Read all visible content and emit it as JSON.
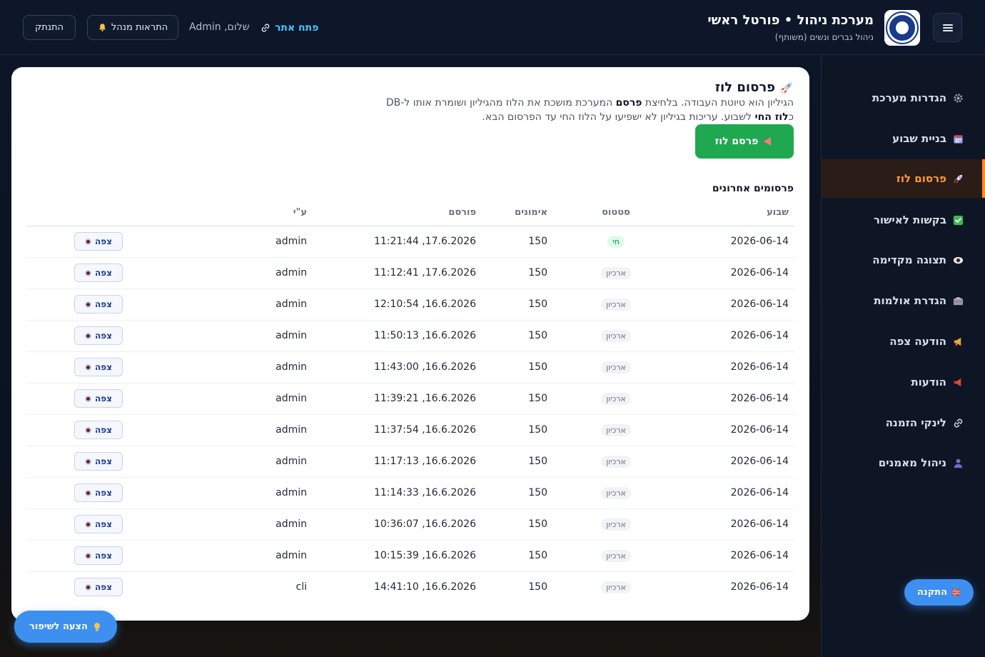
{
  "header": {
    "title": "מערכת ניהול • פורטל ראשי",
    "subtitle": "ניהול גברים ונשים (משותף)",
    "site_link": "פתח אתר",
    "greeting": "שלום, Admin",
    "notify_label": "התראות מנהל",
    "logout_label": "התנתק"
  },
  "sidebar": {
    "items": [
      {
        "label": "הגדרות מערכת",
        "icon": "gear-icon"
      },
      {
        "label": "בניית שבוע",
        "icon": "calendar-icon"
      },
      {
        "label": "פרסום לוז",
        "icon": "rocket-icon",
        "active": true
      },
      {
        "label": "בקשות לאישור",
        "icon": "check-icon"
      },
      {
        "label": "תצוגה מקדימה",
        "icon": "eye-icon"
      },
      {
        "label": "הגדרת אולמות",
        "icon": "stadium-icon"
      },
      {
        "label": "הודעה צפה",
        "icon": "megaphone-icon"
      },
      {
        "label": "הודעות",
        "icon": "loudspeaker-icon"
      },
      {
        "label": "לינקי הזמנה",
        "icon": "link-icon"
      },
      {
        "label": "ניהול מאמנים",
        "icon": "user-icon"
      }
    ]
  },
  "main": {
    "title": "פרסום לוז",
    "desc_line1_a": "הגיליון הוא טיוטת העבודה. בלחיצת ",
    "desc_line1_b": "פרסם",
    "desc_line1_c": " המערכת מושכת את הלוז מהגיליון ושומרת אותו ל-DB",
    "desc_line2_a": "כ",
    "desc_line2_b": "לוז החי",
    "desc_line2_c": " לשבוע. עריכות בגיליון לא ישפיעו על הלוז החי עד הפרסום הבא.",
    "publish_label": "פרסם לוז",
    "section_title": "פרסומים אחרונים",
    "columns": [
      "שבוע",
      "סטטוס",
      "אימונים",
      "פורסם",
      "ע\"י",
      ""
    ],
    "view_label": "צפה",
    "rows": [
      {
        "week": "2026-06-14",
        "status": "חי",
        "live": true,
        "count": "150",
        "published": "17.6.2026, 11:21:44",
        "by": "admin"
      },
      {
        "week": "2026-06-14",
        "status": "ארכיון",
        "live": false,
        "count": "150",
        "published": "17.6.2026, 11:12:41",
        "by": "admin"
      },
      {
        "week": "2026-06-14",
        "status": "ארכיון",
        "live": false,
        "count": "150",
        "published": "16.6.2026, 12:10:54",
        "by": "admin"
      },
      {
        "week": "2026-06-14",
        "status": "ארכיון",
        "live": false,
        "count": "150",
        "published": "16.6.2026, 11:50:13",
        "by": "admin"
      },
      {
        "week": "2026-06-14",
        "status": "ארכיון",
        "live": false,
        "count": "150",
        "published": "16.6.2026, 11:43:00",
        "by": "admin"
      },
      {
        "week": "2026-06-14",
        "status": "ארכיון",
        "live": false,
        "count": "150",
        "published": "16.6.2026, 11:39:21",
        "by": "admin"
      },
      {
        "week": "2026-06-14",
        "status": "ארכיון",
        "live": false,
        "count": "150",
        "published": "16.6.2026, 11:37:54",
        "by": "admin"
      },
      {
        "week": "2026-06-14",
        "status": "ארכיון",
        "live": false,
        "count": "150",
        "published": "16.6.2026, 11:17:13",
        "by": "admin"
      },
      {
        "week": "2026-06-14",
        "status": "ארכיון",
        "live": false,
        "count": "150",
        "published": "16.6.2026, 11:14:33",
        "by": "admin"
      },
      {
        "week": "2026-06-14",
        "status": "ארכיון",
        "live": false,
        "count": "150",
        "published": "16.6.2026, 10:36:07",
        "by": "admin"
      },
      {
        "week": "2026-06-14",
        "status": "ארכיון",
        "live": false,
        "count": "150",
        "published": "16.6.2026, 10:15:39",
        "by": "admin"
      },
      {
        "week": "2026-06-14",
        "status": "ארכיון",
        "live": false,
        "count": "150",
        "published": "16.6.2026, 14:41:10",
        "by": "cli"
      }
    ]
  },
  "floating": {
    "install_label": "התקנה",
    "suggest_label": "הצעה לשיפור"
  },
  "colors": {
    "accent": "#ff8a2a",
    "primary_button": "#1fa84f",
    "floating_button": "#3d8ff0",
    "link": "#4cc3ff"
  }
}
